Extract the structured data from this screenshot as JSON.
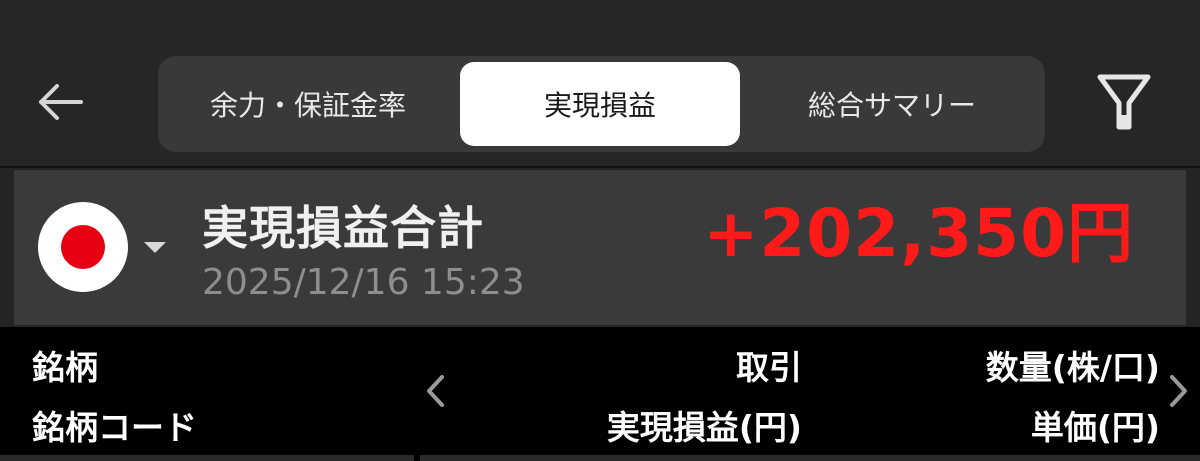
{
  "header": {
    "back_icon": "arrow-left-icon",
    "tabs": [
      {
        "label": "余力・保証金率",
        "active": false
      },
      {
        "label": "実現損益",
        "active": true
      },
      {
        "label": "総合サマリー",
        "active": false
      }
    ],
    "filter_icon": "filter-icon"
  },
  "summary": {
    "flag_icon": "japan-flag-icon",
    "title": "実現損益合計",
    "datetime": "2025/12/16 15:23",
    "total": "+202,350円"
  },
  "table_header": {
    "col1_row1": "銘柄",
    "col1_row2": "銘柄コード",
    "col2_row1": "取引",
    "col2_row2": "実現損益(円)",
    "col3_row1": "数量(株/口)",
    "col3_row2": "単価(円)"
  },
  "colors": {
    "background": "#242424",
    "tab_active_bg": "#ffffff",
    "positive_value": "#ff1a1a",
    "flag_red": "#e60012"
  }
}
